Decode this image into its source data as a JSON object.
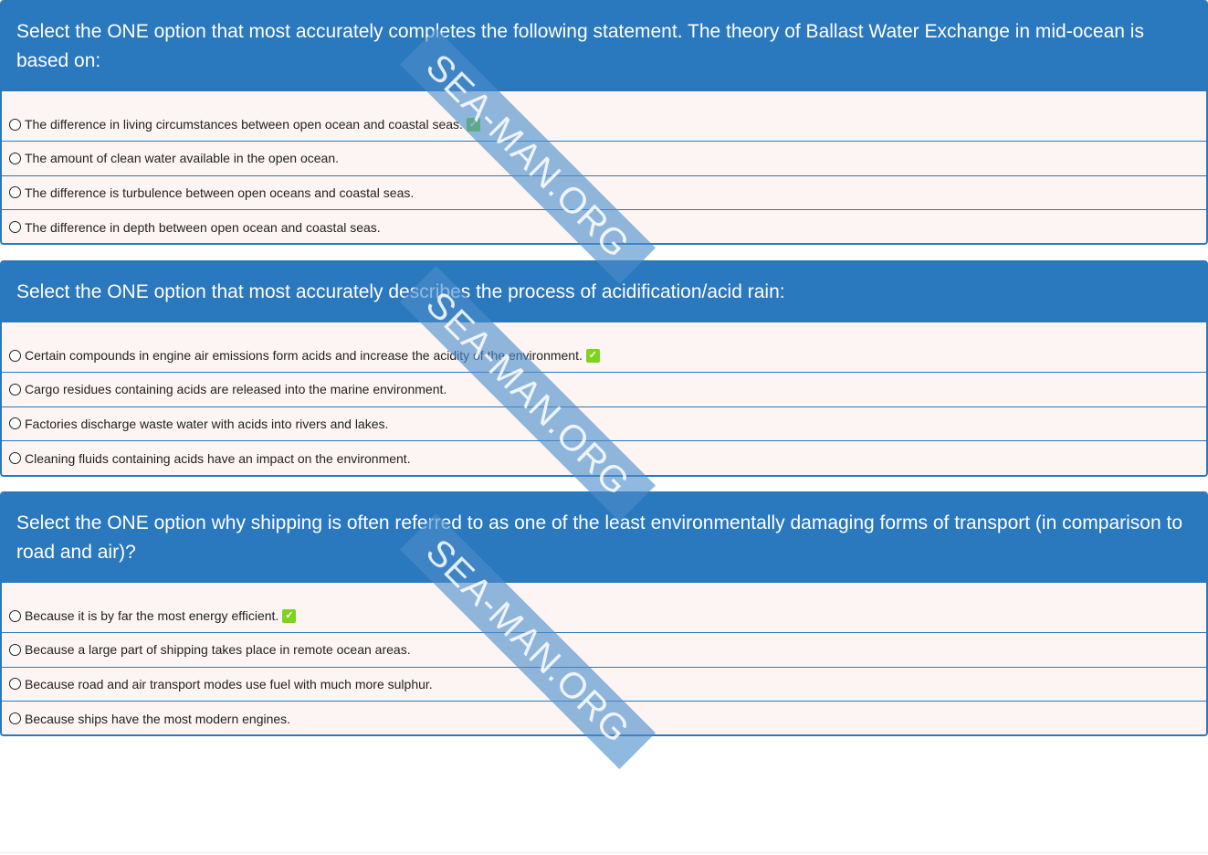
{
  "questions": [
    {
      "prompt": "Select the ONE option that most accurately completes the following statement. The theory of Ballast Water Exchange in mid-ocean is based on:",
      "options": [
        {
          "label": "The difference in living circumstances between open ocean and coastal seas.",
          "correct": true
        },
        {
          "label": "The amount of clean water available in the open ocean.",
          "correct": false
        },
        {
          "label": "The difference is turbulence between open oceans and coastal seas.",
          "correct": false
        },
        {
          "label": "The difference in depth between open ocean and coastal seas.",
          "correct": false
        }
      ]
    },
    {
      "prompt": "Select the ONE option that most accurately describes the process of acidification/acid rain:",
      "options": [
        {
          "label": "Certain compounds in engine air emissions form acids and increase the acidity of the environment.",
          "correct": true
        },
        {
          "label": "Cargo residues containing acids are released into the marine environment.",
          "correct": false
        },
        {
          "label": "Factories discharge waste water with acids into rivers and lakes.",
          "correct": false
        },
        {
          "label": "Cleaning fluids containing acids have an impact on the environment.",
          "correct": false
        }
      ]
    },
    {
      "prompt": "Select the ONE option why shipping is often referred to as one of the least environmentally damaging forms of transport (in comparison to road and air)?",
      "options": [
        {
          "label": "Because it is by far the most energy efficient.",
          "correct": true
        },
        {
          "label": "Because a large part of shipping takes place in remote ocean areas.",
          "correct": false
        },
        {
          "label": "Because road and air transport modes use fuel with much more sulphur.",
          "correct": false
        },
        {
          "label": "Because ships have the most modern engines.",
          "correct": false
        }
      ]
    }
  ],
  "correct_mark": "✓",
  "watermark": "SEA-MAN.ORG",
  "colors": {
    "header": "#2a78bd",
    "panel_bg": "#fdf5f3",
    "check": "#7ed321"
  }
}
